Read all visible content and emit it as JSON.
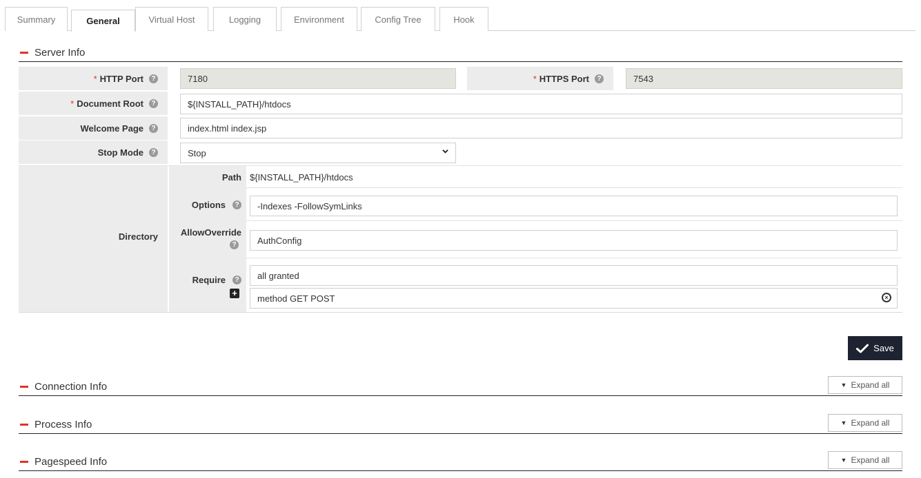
{
  "tabs": [
    {
      "label": "Summary"
    },
    {
      "label": "General"
    },
    {
      "label": "Virtual Host"
    },
    {
      "label": "Logging"
    },
    {
      "label": "Environment"
    },
    {
      "label": "Config Tree"
    },
    {
      "label": "Hook"
    }
  ],
  "active_tab": "General",
  "server_info": {
    "title": "Server Info",
    "http_port": {
      "label": "HTTP Port",
      "value": "7180",
      "required_mark": "*",
      "help": "?"
    },
    "https_port": {
      "label": "HTTPS Port",
      "value": "7543",
      "required_mark": "*",
      "help": "?"
    },
    "document_root": {
      "label": "Document Root",
      "value": "${INSTALL_PATH}/htdocs",
      "required_mark": "*",
      "help": "?"
    },
    "welcome_page": {
      "label": "Welcome Page",
      "value": "index.html index.jsp",
      "help": "?"
    },
    "stop_mode": {
      "label": "Stop Mode",
      "value": "Stop",
      "help": "?"
    },
    "directory": {
      "label": "Directory",
      "path_label": "Path",
      "path_value": "${INSTALL_PATH}/htdocs",
      "options_label": "Options",
      "options_value": "-Indexes -FollowSymLinks",
      "allowoverride_label": "AllowOverride",
      "allowoverride_value": "AuthConfig",
      "require_label": "Require",
      "require_values": [
        "all granted",
        "method GET POST"
      ],
      "add_symbol": "+",
      "remove_symbol": "×"
    }
  },
  "save_label": "Save",
  "sections": [
    {
      "title": "Connection Info",
      "expand_label": "Expand all"
    },
    {
      "title": "Process Info",
      "expand_label": "Expand all"
    },
    {
      "title": "Pagespeed Info",
      "expand_label": "Expand all"
    }
  ],
  "icons": {
    "expand": "chevron-down-icon",
    "save": "check-icon",
    "help": "question-circle-icon"
  },
  "colors": {
    "accent_red": "#e0322c",
    "save_bg": "#1d2330",
    "label_bg": "#ececec",
    "readonly_bg": "#e5e5e0"
  }
}
